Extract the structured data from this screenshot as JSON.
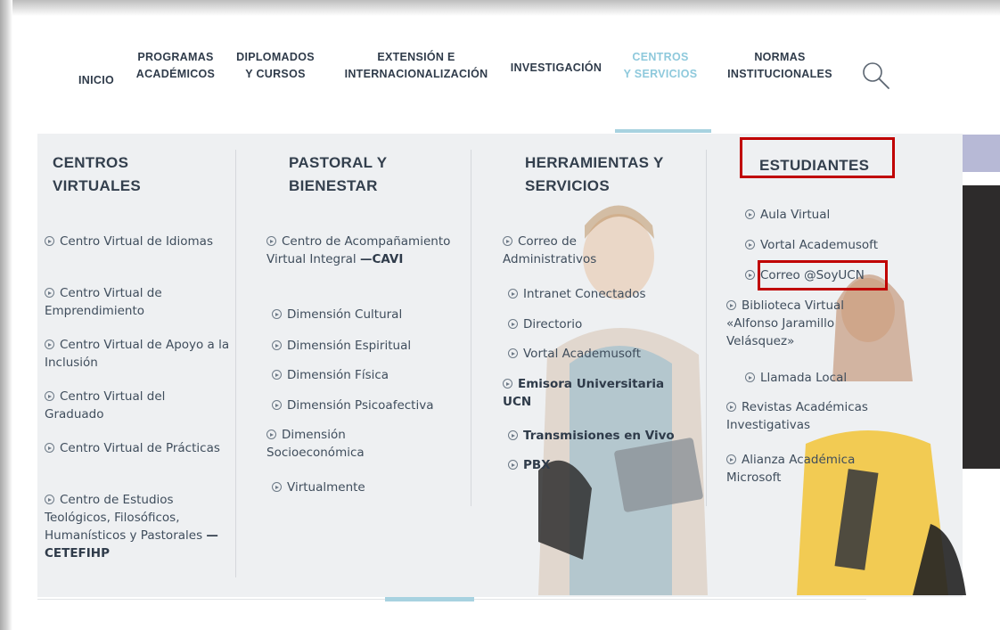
{
  "nav": {
    "items": [
      {
        "lines": [
          "INICIO"
        ]
      },
      {
        "lines": [
          "PROGRAMAS",
          "ACADÉMICOS"
        ]
      },
      {
        "lines": [
          "DIPLOMADOS",
          "Y CURSOS"
        ]
      },
      {
        "lines": [
          "EXTENSIÓN E",
          "INTERNACIONALIZACIÓN"
        ]
      },
      {
        "lines": [
          "INVESTIGACIÓN"
        ]
      },
      {
        "lines": [
          "CENTROS",
          "Y SERVICIOS"
        ]
      },
      {
        "lines": [
          "NORMAS",
          "INSTITUCIONALES"
        ]
      }
    ],
    "active_index": 5,
    "accent_color": "#8ec9dc",
    "search_icon": "search-icon"
  },
  "menu": {
    "columns": [
      {
        "title": [
          "CENTROS",
          "VIRTUALES"
        ],
        "links": [
          {
            "text": "Centro Virtual de Idiomas"
          },
          {
            "text": "Centro Virtual de Emprendimiento"
          },
          {
            "text": "Centro Virtual de Apoyo a la Inclusión"
          },
          {
            "text": "Centro Virtual del Graduado"
          },
          {
            "text": "Centro Virtual de Prácticas"
          },
          {
            "text": "Centro de Estudios Teológicos, Filosóficos, Humanísticos y Pastorales",
            "bold": "—CETEFIHP"
          }
        ]
      },
      {
        "title": [
          "PASTORAL Y",
          "BIENESTAR"
        ],
        "links": [
          {
            "text": "Centro de Acompañamiento Virtual Integral",
            "bold": "—CAVI"
          },
          {
            "text": "Dimensión Cultural"
          },
          {
            "text": "Dimensión Espiritual"
          },
          {
            "text": "Dimensión Física"
          },
          {
            "text": "Dimensión Psicoafectiva"
          },
          {
            "text": "Dimensión Socioeconómica"
          },
          {
            "text": "Virtualmente"
          }
        ]
      },
      {
        "title": [
          "HERRAMIENTAS Y",
          "SERVICIOS"
        ],
        "links": [
          {
            "text": "Correo de Administrativos"
          },
          {
            "text": "Intranet Conectados"
          },
          {
            "text": "Directorio"
          },
          {
            "text": "Vortal Academusoft"
          },
          {
            "bold": "Emisora Universitaria UCN"
          },
          {
            "bold": "Transmisiones en Vivo"
          },
          {
            "bold": "PBX"
          }
        ]
      },
      {
        "title": [
          "ESTUDIANTES"
        ],
        "links": [
          {
            "text": "Aula Virtual"
          },
          {
            "text": "Vortal Academusoft"
          },
          {
            "text": "Correo @SoyUCN",
            "highlighted": true
          },
          {
            "text": "Biblioteca Virtual «Alfonso Jaramillo Velásquez»"
          },
          {
            "text": "Llamada Local"
          },
          {
            "text": "Revistas Académicas Investigativas"
          },
          {
            "text": "Alianza Académica Microsoft"
          }
        ]
      }
    ],
    "highlight_color": "#c00000"
  }
}
